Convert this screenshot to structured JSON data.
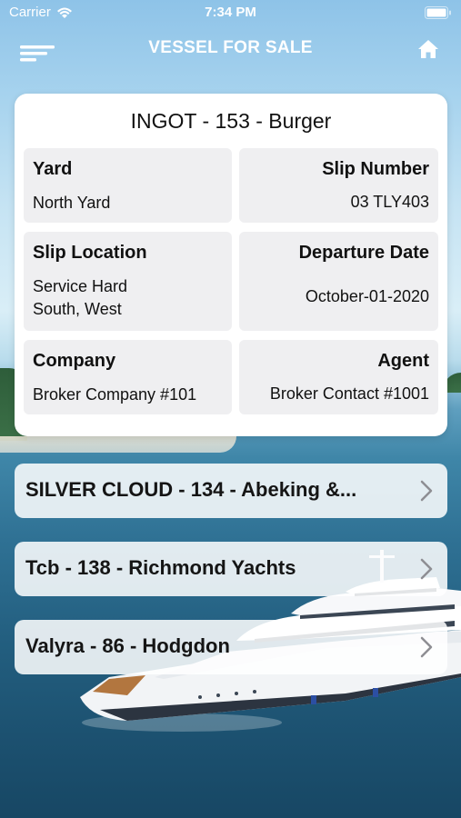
{
  "status_bar": {
    "carrier": "Carrier",
    "time": "7:34 PM",
    "icons": [
      "wifi-icon",
      "battery-icon"
    ]
  },
  "nav": {
    "title": "VESSEL FOR SALE",
    "left_icon": "menu-icon",
    "right_icon": "home-icon"
  },
  "vessel_detail": {
    "title": "INGOT - 153 - Burger",
    "fields": {
      "yard": {
        "label": "Yard",
        "value": "North Yard"
      },
      "slip_number": {
        "label": "Slip Number",
        "value": "03 TLY403"
      },
      "slip_location": {
        "label": "Slip Location",
        "value_line1": "Service Hard",
        "value_line2": "South, West"
      },
      "departure_date": {
        "label": "Departure Date",
        "value": "October-01-2020"
      },
      "company": {
        "label": "Company",
        "value": "Broker Company #101"
      },
      "agent": {
        "label": "Agent",
        "value": "Broker Contact #1001"
      }
    }
  },
  "vessels": [
    {
      "label": "SILVER CLOUD - 134 - Abeking &..."
    },
    {
      "label": "Tcb - 138 - Richmond Yachts"
    },
    {
      "label": "Valyra - 86 - Hodgdon"
    }
  ],
  "colors": {
    "card_bg": "#ffffff",
    "cell_bg": "#efeff1",
    "nav_text": "#ffffff"
  }
}
